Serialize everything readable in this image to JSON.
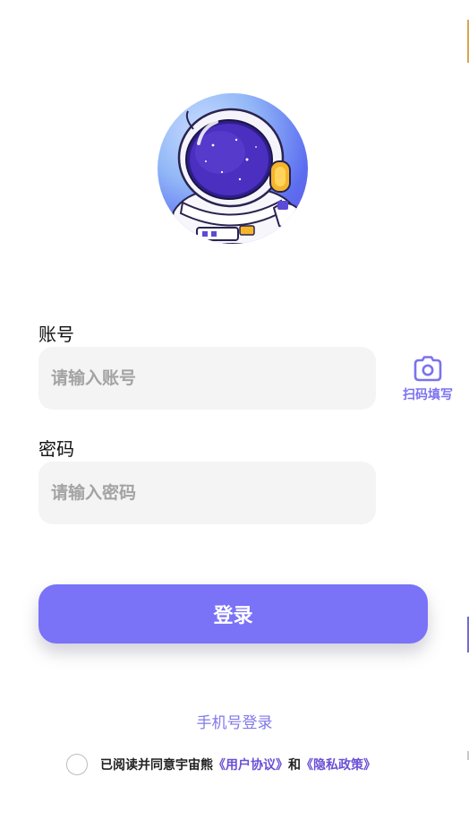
{
  "avatar": {
    "icon": "astronaut-avatar"
  },
  "form": {
    "account_label": "账号",
    "account_placeholder": "请输入账号",
    "account_value": "",
    "password_label": "密码",
    "password_placeholder": "请输入密码",
    "password_value": ""
  },
  "scan": {
    "icon": "camera-icon",
    "label": "扫码填写"
  },
  "login_button": "登录",
  "phone_login": "手机号登录",
  "agreement": {
    "checked": false,
    "prefix": "已阅读并同意宇宙熊",
    "user_agreement": "《用户协议》",
    "connector": "和",
    "privacy_policy": "《隐私政策》"
  },
  "colors": {
    "accent": "#7a72f7",
    "link": "#6b4fd6",
    "input_bg": "#f4f4f4"
  }
}
